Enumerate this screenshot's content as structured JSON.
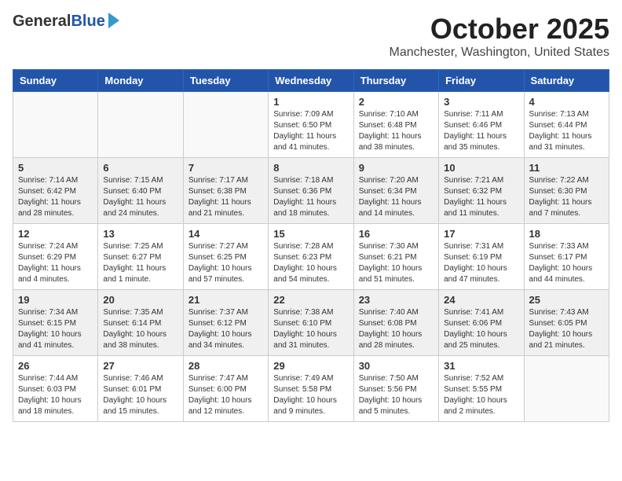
{
  "header": {
    "logo_general": "General",
    "logo_blue": "Blue",
    "month_title": "October 2025",
    "location": "Manchester, Washington, United States"
  },
  "days_of_week": [
    "Sunday",
    "Monday",
    "Tuesday",
    "Wednesday",
    "Thursday",
    "Friday",
    "Saturday"
  ],
  "weeks": [
    [
      {
        "day": "",
        "info": ""
      },
      {
        "day": "",
        "info": ""
      },
      {
        "day": "",
        "info": ""
      },
      {
        "day": "1",
        "info": "Sunrise: 7:09 AM\nSunset: 6:50 PM\nDaylight: 11 hours and 41 minutes."
      },
      {
        "day": "2",
        "info": "Sunrise: 7:10 AM\nSunset: 6:48 PM\nDaylight: 11 hours and 38 minutes."
      },
      {
        "day": "3",
        "info": "Sunrise: 7:11 AM\nSunset: 6:46 PM\nDaylight: 11 hours and 35 minutes."
      },
      {
        "day": "4",
        "info": "Sunrise: 7:13 AM\nSunset: 6:44 PM\nDaylight: 11 hours and 31 minutes."
      }
    ],
    [
      {
        "day": "5",
        "info": "Sunrise: 7:14 AM\nSunset: 6:42 PM\nDaylight: 11 hours and 28 minutes."
      },
      {
        "day": "6",
        "info": "Sunrise: 7:15 AM\nSunset: 6:40 PM\nDaylight: 11 hours and 24 minutes."
      },
      {
        "day": "7",
        "info": "Sunrise: 7:17 AM\nSunset: 6:38 PM\nDaylight: 11 hours and 21 minutes."
      },
      {
        "day": "8",
        "info": "Sunrise: 7:18 AM\nSunset: 6:36 PM\nDaylight: 11 hours and 18 minutes."
      },
      {
        "day": "9",
        "info": "Sunrise: 7:20 AM\nSunset: 6:34 PM\nDaylight: 11 hours and 14 minutes."
      },
      {
        "day": "10",
        "info": "Sunrise: 7:21 AM\nSunset: 6:32 PM\nDaylight: 11 hours and 11 minutes."
      },
      {
        "day": "11",
        "info": "Sunrise: 7:22 AM\nSunset: 6:30 PM\nDaylight: 11 hours and 7 minutes."
      }
    ],
    [
      {
        "day": "12",
        "info": "Sunrise: 7:24 AM\nSunset: 6:29 PM\nDaylight: 11 hours and 4 minutes."
      },
      {
        "day": "13",
        "info": "Sunrise: 7:25 AM\nSunset: 6:27 PM\nDaylight: 11 hours and 1 minute."
      },
      {
        "day": "14",
        "info": "Sunrise: 7:27 AM\nSunset: 6:25 PM\nDaylight: 10 hours and 57 minutes."
      },
      {
        "day": "15",
        "info": "Sunrise: 7:28 AM\nSunset: 6:23 PM\nDaylight: 10 hours and 54 minutes."
      },
      {
        "day": "16",
        "info": "Sunrise: 7:30 AM\nSunset: 6:21 PM\nDaylight: 10 hours and 51 minutes."
      },
      {
        "day": "17",
        "info": "Sunrise: 7:31 AM\nSunset: 6:19 PM\nDaylight: 10 hours and 47 minutes."
      },
      {
        "day": "18",
        "info": "Sunrise: 7:33 AM\nSunset: 6:17 PM\nDaylight: 10 hours and 44 minutes."
      }
    ],
    [
      {
        "day": "19",
        "info": "Sunrise: 7:34 AM\nSunset: 6:15 PM\nDaylight: 10 hours and 41 minutes."
      },
      {
        "day": "20",
        "info": "Sunrise: 7:35 AM\nSunset: 6:14 PM\nDaylight: 10 hours and 38 minutes."
      },
      {
        "day": "21",
        "info": "Sunrise: 7:37 AM\nSunset: 6:12 PM\nDaylight: 10 hours and 34 minutes."
      },
      {
        "day": "22",
        "info": "Sunrise: 7:38 AM\nSunset: 6:10 PM\nDaylight: 10 hours and 31 minutes."
      },
      {
        "day": "23",
        "info": "Sunrise: 7:40 AM\nSunset: 6:08 PM\nDaylight: 10 hours and 28 minutes."
      },
      {
        "day": "24",
        "info": "Sunrise: 7:41 AM\nSunset: 6:06 PM\nDaylight: 10 hours and 25 minutes."
      },
      {
        "day": "25",
        "info": "Sunrise: 7:43 AM\nSunset: 6:05 PM\nDaylight: 10 hours and 21 minutes."
      }
    ],
    [
      {
        "day": "26",
        "info": "Sunrise: 7:44 AM\nSunset: 6:03 PM\nDaylight: 10 hours and 18 minutes."
      },
      {
        "day": "27",
        "info": "Sunrise: 7:46 AM\nSunset: 6:01 PM\nDaylight: 10 hours and 15 minutes."
      },
      {
        "day": "28",
        "info": "Sunrise: 7:47 AM\nSunset: 6:00 PM\nDaylight: 10 hours and 12 minutes."
      },
      {
        "day": "29",
        "info": "Sunrise: 7:49 AM\nSunset: 5:58 PM\nDaylight: 10 hours and 9 minutes."
      },
      {
        "day": "30",
        "info": "Sunrise: 7:50 AM\nSunset: 5:56 PM\nDaylight: 10 hours and 5 minutes."
      },
      {
        "day": "31",
        "info": "Sunrise: 7:52 AM\nSunset: 5:55 PM\nDaylight: 10 hours and 2 minutes."
      },
      {
        "day": "",
        "info": ""
      }
    ]
  ]
}
